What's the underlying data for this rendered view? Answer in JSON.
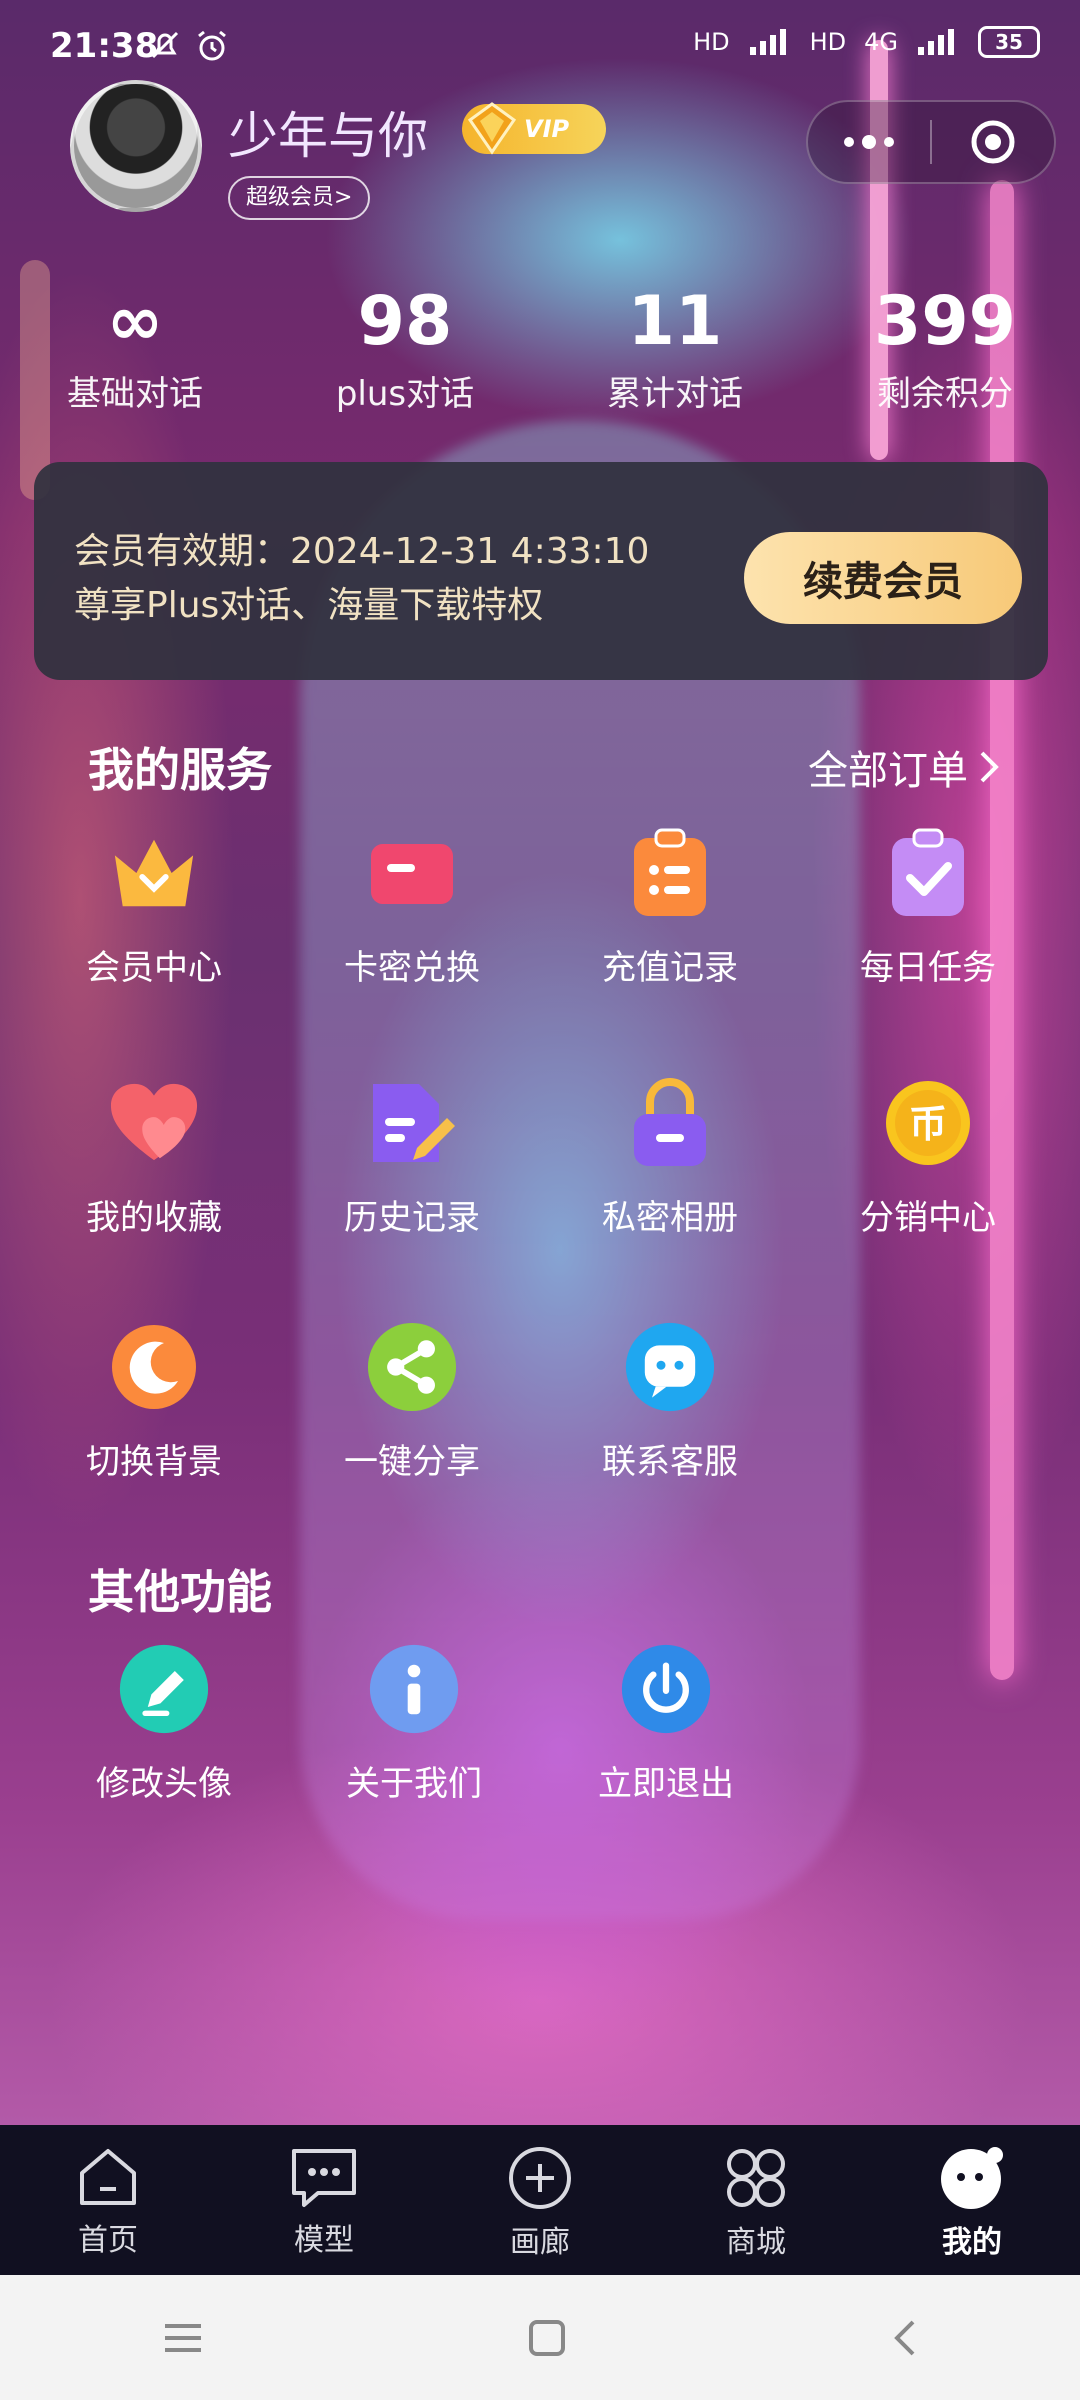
{
  "status_bar": {
    "time": "21:38",
    "signal_1": "HD",
    "signal_2": "HD",
    "network": "4G",
    "battery": "35"
  },
  "profile": {
    "name": "少年与你",
    "vip_label": "VIP",
    "member_tag": "超级会员>"
  },
  "stats": [
    {
      "value": "∞",
      "label": "基础对话"
    },
    {
      "value": "98",
      "label": "plus对话"
    },
    {
      "value": "11",
      "label": "累计对话"
    },
    {
      "value": "399",
      "label": "剩余积分"
    }
  ],
  "membership": {
    "expiry": "会员有效期：2024-12-31 4:33:10",
    "privileges": "尊享Plus对话、海量下载特权",
    "renew_label": "续费会员"
  },
  "services": {
    "title": "我的服务",
    "all_orders": "全部订单",
    "items": [
      {
        "label": "会员中心",
        "icon": "crown-icon"
      },
      {
        "label": "卡密兑换",
        "icon": "card-icon"
      },
      {
        "label": "充值记录",
        "icon": "clipboard-list-icon"
      },
      {
        "label": "每日任务",
        "icon": "checklist-icon"
      },
      {
        "label": "我的收藏",
        "icon": "heart-icon"
      },
      {
        "label": "历史记录",
        "icon": "document-edit-icon"
      },
      {
        "label": "私密相册",
        "icon": "lock-icon"
      },
      {
        "label": "分销中心",
        "icon": "coin-icon"
      },
      {
        "label": "切换背景",
        "icon": "moon-icon"
      },
      {
        "label": "一键分享",
        "icon": "share-icon"
      },
      {
        "label": "联系客服",
        "icon": "chat-bubble-icon"
      }
    ]
  },
  "others": {
    "title": "其他功能",
    "items": [
      {
        "label": "修改头像",
        "icon": "pencil-icon"
      },
      {
        "label": "关于我们",
        "icon": "info-icon"
      },
      {
        "label": "立即退出",
        "icon": "power-icon"
      }
    ]
  },
  "tabs": [
    {
      "label": "首页",
      "icon": "home-icon"
    },
    {
      "label": "模型",
      "icon": "message-icon"
    },
    {
      "label": "画廊",
      "icon": "plus-circle-icon"
    },
    {
      "label": "商城",
      "icon": "grid-icon"
    },
    {
      "label": "我的",
      "icon": "profile-face-icon"
    }
  ],
  "active_tab": "我的"
}
